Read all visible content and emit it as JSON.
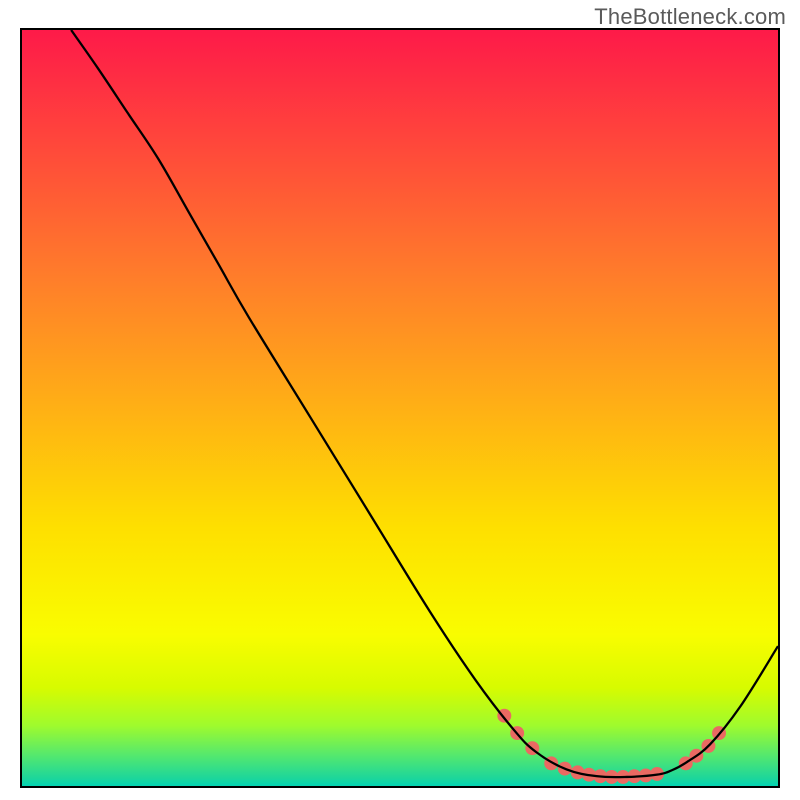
{
  "watermark": "TheBottleneck.com",
  "chart_data": {
    "type": "line",
    "title": "",
    "xlabel": "",
    "ylabel": "",
    "xlim": [
      0,
      100
    ],
    "ylim": [
      0,
      100
    ],
    "grid": false,
    "legend": false,
    "background_gradient": {
      "stops": [
        {
          "pos": 0.0,
          "color": "#fe1a49"
        },
        {
          "pos": 0.16,
          "color": "#ff4a3a"
        },
        {
          "pos": 0.33,
          "color": "#ff7e2a"
        },
        {
          "pos": 0.5,
          "color": "#ffb015"
        },
        {
          "pos": 0.66,
          "color": "#fee000"
        },
        {
          "pos": 0.8,
          "color": "#f9fd00"
        },
        {
          "pos": 0.87,
          "color": "#d7fb00"
        },
        {
          "pos": 0.92,
          "color": "#9ffb2d"
        },
        {
          "pos": 0.96,
          "color": "#53e86f"
        },
        {
          "pos": 0.99,
          "color": "#1cd69b"
        },
        {
          "pos": 1.0,
          "color": "#03d4b3"
        }
      ]
    },
    "series": [
      {
        "name": "bottleneck-curve",
        "color": "#000000",
        "x": [
          6.5,
          10,
          14,
          18,
          22,
          26,
          30,
          38,
          46,
          54,
          60,
          65,
          68,
          72,
          76,
          80,
          84,
          86,
          88,
          91,
          95,
          100
        ],
        "y": [
          100,
          95,
          89,
          83,
          76,
          69,
          62,
          49,
          36,
          23,
          14,
          7.5,
          4.5,
          2.2,
          1.3,
          1.2,
          1.5,
          2.1,
          3.2,
          5.5,
          10.5,
          18.5
        ]
      }
    ],
    "markers": {
      "name": "highlight-dots",
      "color": "#ea6962",
      "radius": 7,
      "points": [
        {
          "x": 63.8,
          "y": 9.3
        },
        {
          "x": 65.5,
          "y": 7.0
        },
        {
          "x": 67.5,
          "y": 5.0
        },
        {
          "x": 70.0,
          "y": 3.0
        },
        {
          "x": 71.8,
          "y": 2.3
        },
        {
          "x": 73.5,
          "y": 1.8
        },
        {
          "x": 75.0,
          "y": 1.5
        },
        {
          "x": 76.5,
          "y": 1.3
        },
        {
          "x": 78.0,
          "y": 1.2
        },
        {
          "x": 79.5,
          "y": 1.2
        },
        {
          "x": 81.0,
          "y": 1.3
        },
        {
          "x": 82.5,
          "y": 1.4
        },
        {
          "x": 84.0,
          "y": 1.6
        },
        {
          "x": 87.8,
          "y": 3.0
        },
        {
          "x": 89.2,
          "y": 4.0
        },
        {
          "x": 90.8,
          "y": 5.3
        },
        {
          "x": 92.2,
          "y": 7.0
        }
      ]
    }
  }
}
